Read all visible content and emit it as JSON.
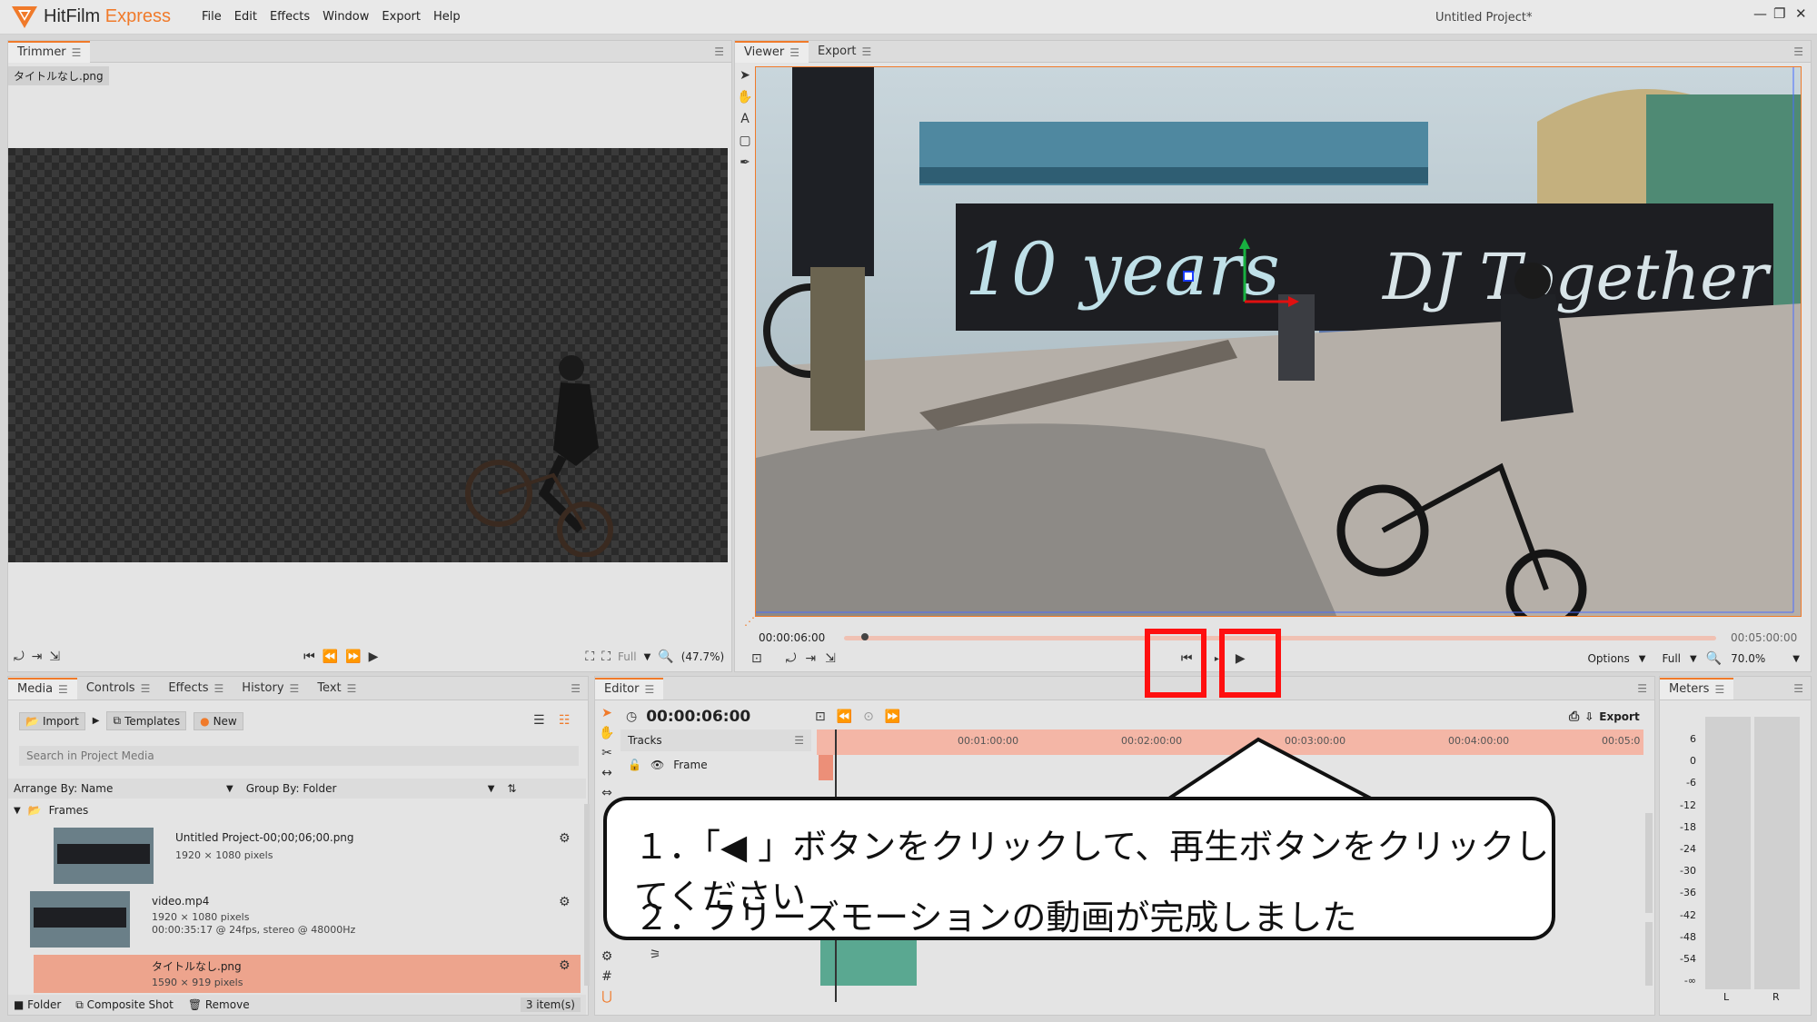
{
  "app": {
    "brand_main": "HitFilm",
    "brand_accent": "Express",
    "project_title": "Untitled Project*"
  },
  "menu": [
    "File",
    "Edit",
    "Effects",
    "Window",
    "Export",
    "Help"
  ],
  "window_controls": {
    "minimize": "—",
    "restore": "❐",
    "close": "✕"
  },
  "trimmer": {
    "tab": "Trimmer",
    "file": "タイトルなし.png",
    "quality": "Full",
    "zoom": "(47.7%)"
  },
  "viewer": {
    "tabs": [
      "Viewer",
      "Export"
    ],
    "time_current": "00:00:06:00",
    "time_end": "00:05:00:00",
    "options": "Options",
    "quality": "Full",
    "zoom": "70.0%",
    "scrub_progress": 0.02
  },
  "media_panel": {
    "tabs": [
      "Media",
      "Controls",
      "Effects",
      "History",
      "Text"
    ],
    "import": "Import",
    "templates": "Templates",
    "new": "New",
    "search_placeholder": "Search in Project Media",
    "arrange": "Arrange By: Name",
    "group": "Group By: Folder",
    "folder": "Frames",
    "items": [
      {
        "name": "Untitled Project-00;00;06;00.png",
        "line1": "1920 × 1080 pixels",
        "line2": ""
      },
      {
        "name": "video.mp4",
        "line1": "1920 × 1080 pixels",
        "line2": "00:00:35:17 @ 24fps, stereo @ 48000Hz"
      },
      {
        "name": "タイトルなし.png",
        "line1": "1590 × 919 pixels",
        "line2": ""
      }
    ],
    "footer_folder": "Folder",
    "footer_composite": "Composite Shot",
    "footer_remove": "Remove",
    "count": "3 item(s)"
  },
  "editor": {
    "tab": "Editor",
    "timecode": "00:00:06:00",
    "export": "Export",
    "tracks_label": "Tracks",
    "frame_track": "Frame",
    "ruler": [
      "00:01:00:00",
      "00:02:00:00",
      "00:03:00:00",
      "00:04:00:00",
      "00:05:0"
    ]
  },
  "meters": {
    "tab": "Meters",
    "scale": [
      "6",
      "0",
      "-6",
      "-12",
      "-18",
      "-24",
      "-30",
      "-36",
      "-42",
      "-48",
      "-54",
      "-∞"
    ],
    "left": "L",
    "right": "R"
  },
  "callout": {
    "line1": "１．「◀ 」ボタンをクリックして、再生ボタンをクリックしてください",
    "line2": "２．フリーズモーションの動画が完成しました"
  },
  "colors": {
    "accent": "#f07a2a",
    "highlight_red": "#ff1010",
    "timeline_pink": "#f4b6a6",
    "clip_teal": "#5aa891",
    "selected_row": "#eda48d"
  }
}
